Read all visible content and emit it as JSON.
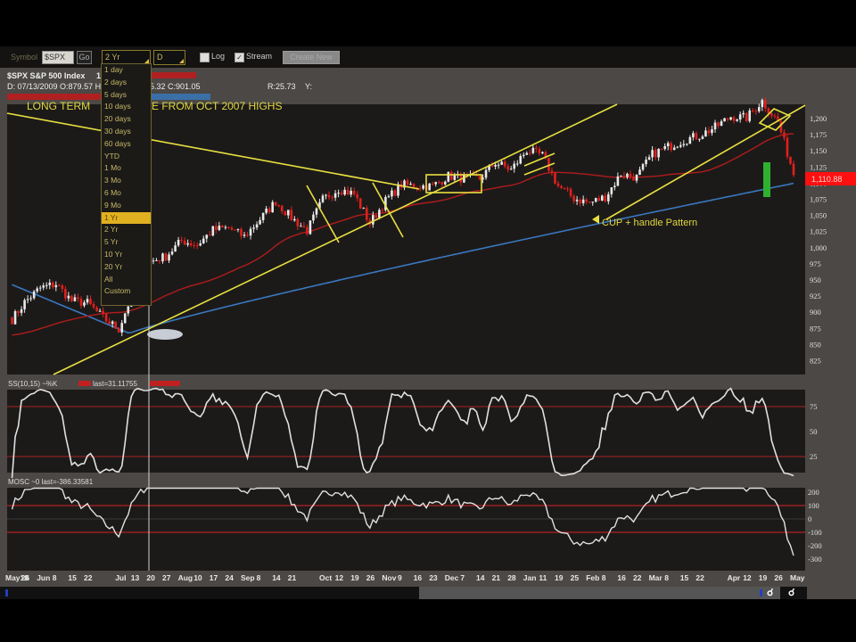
{
  "toolbar": {
    "symbol_label": "Symbol",
    "symbol_value": "$SPX",
    "go_label": "Go",
    "range_value": "2 Yr",
    "interval_value": "D",
    "log_label": "Log",
    "log_checked": false,
    "stream_label": "Stream",
    "stream_checked": true,
    "checkmark": "✓",
    "disabled_button_label": "Create New"
  },
  "range_dropdown": {
    "items": [
      "1 day",
      "2 days",
      "5 days",
      "10 days",
      "20 days",
      "30 days",
      "60 days",
      "YTD",
      "1 Mo",
      "3 Mo",
      "6 Mo",
      "9 Mo",
      "1 Yr",
      "2 Yr",
      "5 Yr",
      "10 Yr",
      "20 Yr",
      "All",
      "Custom"
    ],
    "highlighted": "1 Yr"
  },
  "header": {
    "title": "$SPX S&P 500 Index",
    "title_suffix": "1",
    "ohlc_left": "D: 07/13/2009 O:879.57 H",
    "ohlc_right": "5.32 C:901.05",
    "r_value": "R:25.73",
    "y_label": "Y:"
  },
  "annotations": {
    "trend_left": "LONG TERM",
    "trend_right": "E FROM OCT 2007 HIGHS",
    "cup": "CUP + handle Pattern"
  },
  "price_axis": {
    "ticks": [
      "1,200",
      "1,175",
      "1,150",
      "1,125",
      "1,100",
      "1,075",
      "1,050",
      "1,025",
      "1,000",
      "975",
      "950",
      "925",
      "900",
      "875",
      "850",
      "825"
    ],
    "last_price": "1,110.88"
  },
  "ss_panel": {
    "title": "SS(10,15) ~%K",
    "last": "last=31.11755",
    "ticks": [
      "75",
      "50",
      "25"
    ]
  },
  "mosc_panel": {
    "title": "MOSC ~0 last=-386.33581",
    "ticks": [
      "200",
      "100",
      "0",
      "-100",
      "-200",
      "-300"
    ]
  },
  "colors": {
    "up": "#e8e8e8",
    "down": "#e0201c",
    "ma_short": "#c0201c",
    "ma_long": "#3a78c0",
    "trend": "#e8e040",
    "signal": "#30b030"
  },
  "chart_data": {
    "type": "candlestick",
    "weekly_closes": [
      887,
      919,
      940,
      946,
      921,
      918,
      896,
      879,
      940,
      979,
      987,
      1010,
      1004,
      1026,
      1029,
      1016,
      1042,
      1068,
      1044,
      1025,
      1071,
      1087,
      1079,
      1036,
      1069,
      1093,
      1091,
      1091,
      1106,
      1102,
      1102,
      1126,
      1115,
      1144,
      1136,
      1091,
      1073,
      1066,
      1075,
      1109,
      1104,
      1138,
      1149,
      1159,
      1166,
      1178,
      1194,
      1192,
      1217,
      1186,
      1110
    ],
    "x_labels": [
      "May18",
      "26",
      "Jun",
      "8",
      "15",
      "22",
      "",
      "Jul",
      "13",
      "20",
      "27",
      "Aug",
      "10",
      "17",
      "24",
      "Sep",
      "8",
      "14",
      "21",
      "",
      "Oct",
      "12",
      "19",
      "26",
      "Nov",
      "9",
      "16",
      "23",
      "Dec",
      "7",
      "14",
      "21",
      "28",
      "Jan",
      "11",
      "19",
      "25",
      "Feb",
      "8",
      "16",
      "22",
      "Mar",
      "8",
      "15",
      "22",
      "",
      "Apr",
      "12",
      "19",
      "26",
      "May"
    ],
    "ylim": [
      812,
      1212
    ]
  }
}
